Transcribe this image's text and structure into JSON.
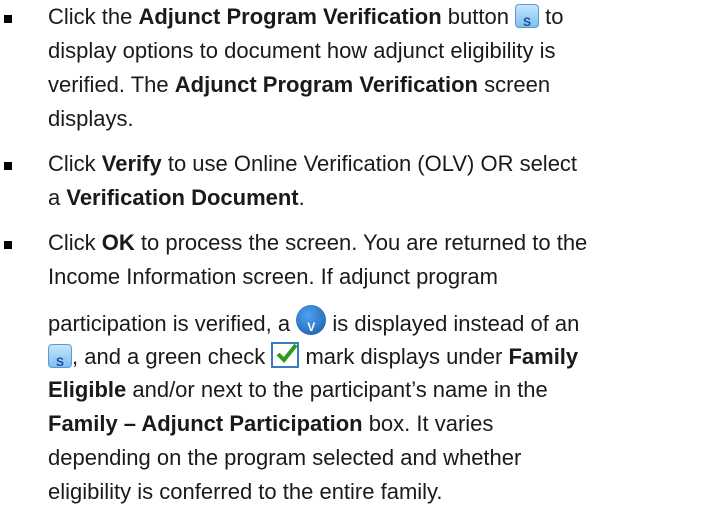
{
  "bullets": [
    {
      "lines": [
        {
          "a": "Click the ",
          "b": "Adjunct Program Verification",
          "c": " button ",
          "d": " to"
        },
        {
          "a": "display options to document how adjunct eligibility is"
        },
        {
          "a": "verified. The ",
          "b": "Adjunct Program Verification",
          "c": " screen"
        },
        {
          "a": "displays."
        }
      ]
    },
    {
      "lines": [
        {
          "a": "Click ",
          "b": "Verify",
          "c": " to use Online Verification (OLV) OR select"
        },
        {
          "a": "a ",
          "b": "Verification Document",
          "c": "."
        }
      ]
    },
    {
      "lines": [
        {
          "a": "Click ",
          "b": "OK",
          "c": " to process the screen. You are returned to the"
        },
        {
          "a": "Income Information screen. If adjunct program"
        },
        {
          "a": "participation is verified, a ",
          "c": " is displayed instead of an"
        },
        {
          "a": ", and a green check ",
          "c": " mark displays under ",
          "b": "Family"
        },
        {
          "b": "Eligible",
          "c": " and/or next to the participant’s name in the"
        },
        {
          "b": "Family – Adjunct Participation",
          "c": " box. It varies"
        },
        {
          "a": "depending on the program selected and whether"
        },
        {
          "a": "eligibility is conferred to the entire family."
        }
      ]
    }
  ],
  "icons": {
    "s_icon": "s-verify-icon",
    "v_icon": "v-verified-icon",
    "check": "green-check-icon"
  },
  "colors": {
    "check_green": "#2e9a1e",
    "icon_blue": "#1a56a8"
  }
}
